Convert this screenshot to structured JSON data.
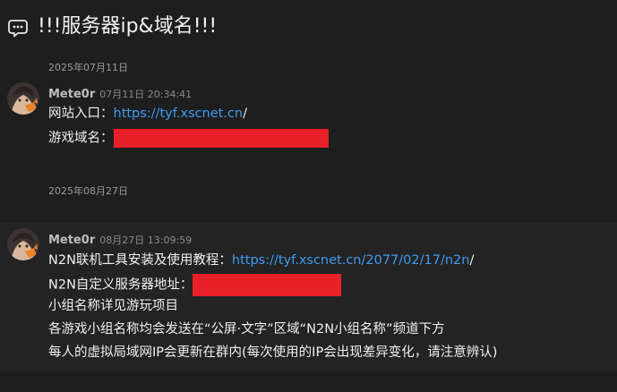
{
  "channel": {
    "title": "!!!服务器ip&域名!!!"
  },
  "messages": [
    {
      "date": "2025年07月11日",
      "author": "Mete0r",
      "time": "07月11日 20:34:41",
      "lines": {
        "l1_label": "网站入口：",
        "l1_link": "https://tyf.xscnet.cn",
        "l1_tail": "/",
        "l2_label": "游戏域名："
      }
    },
    {
      "date": "2025年08月27日",
      "author": "Mete0r",
      "time": "08月27日 13:09:59",
      "lines": {
        "l1_label": "N2N联机工具安装及使用教程：",
        "l1_link": "https://tyf.xscnet.cn/2077/02/17/n2n",
        "l1_tail": "/",
        "l2_label": "N2N自定义服务器地址：",
        "l3": "小组名称详见游玩项目",
        "l4": "各游戏小组名称均会发送在“公屏·文字”区域“N2N小组名称”频道下方",
        "l5": "每人的虚拟局域网IP会更新在群内(每次使用的IP会出现差异变化，请注意辨认)"
      }
    }
  ],
  "colors": {
    "link": "#3d9bf0",
    "redaction": "#e8202a",
    "background": "#1e1e1f"
  }
}
